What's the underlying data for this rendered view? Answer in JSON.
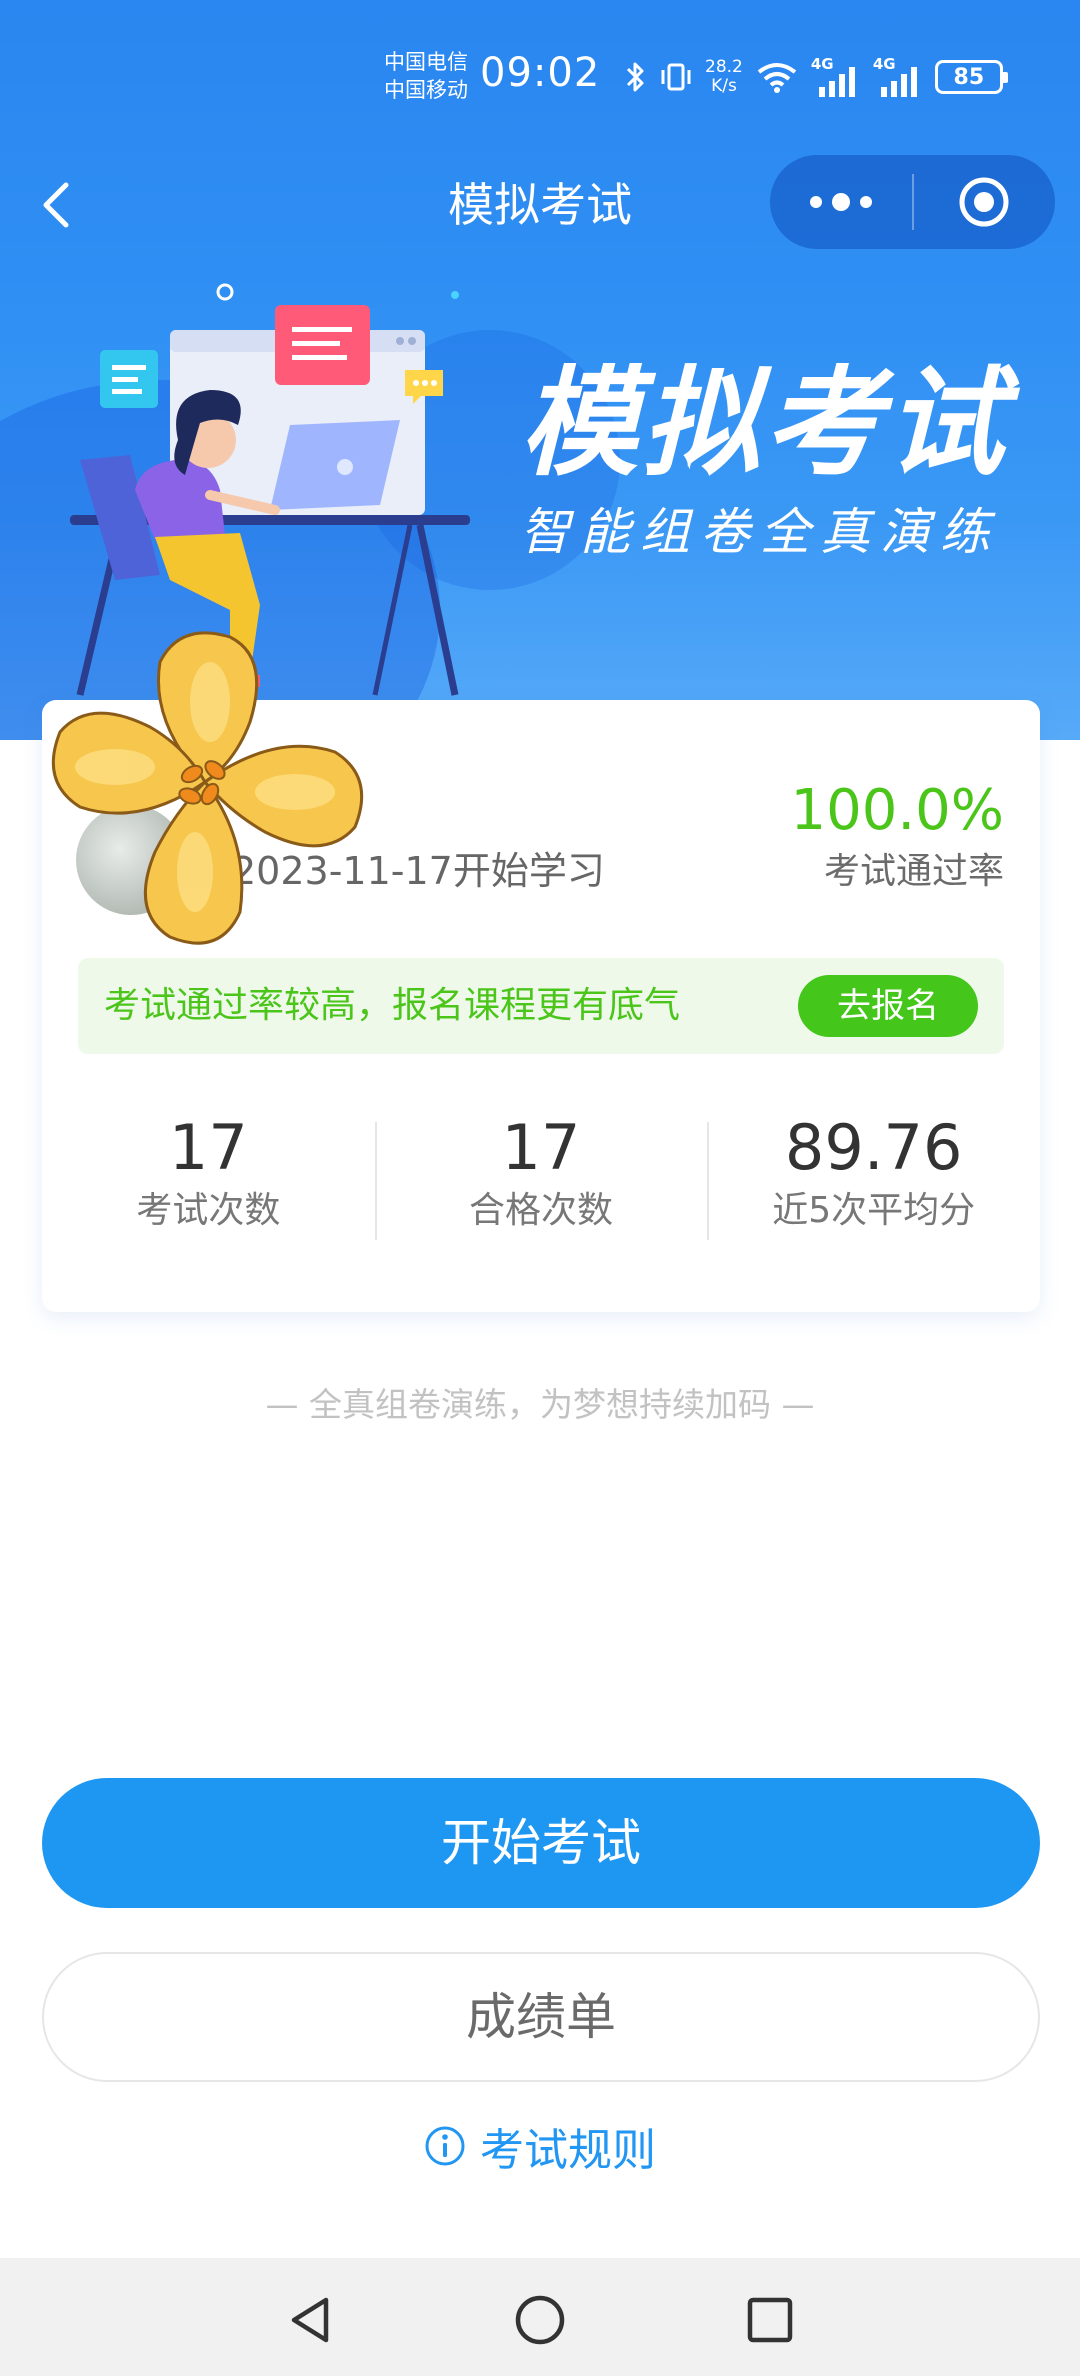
{
  "status_bar": {
    "carrier_1": "中国电信",
    "carrier_2": "中国移动",
    "time": "09:02",
    "net_speed_value": "28.2",
    "net_speed_unit": "K/s",
    "signal_1": "4G",
    "signal_2": "4G",
    "battery": "85"
  },
  "nav": {
    "title": "模拟考试",
    "back_icon": "chevron-left-icon",
    "more_icon": "more-dots-icon",
    "close_icon": "target-circle-icon"
  },
  "banner": {
    "title": "模拟考试",
    "subtitle": "智能组卷全真演练"
  },
  "card": {
    "study_date": "2023-11-17开始学习",
    "pass_rate": "100.0%",
    "pass_rate_label": "考试通过率",
    "promo_text": "考试通过率较高，报名课程更有底气",
    "promo_button": "去报名",
    "stats": [
      {
        "value": "17",
        "label": "考试次数"
      },
      {
        "value": "17",
        "label": "合格次数"
      },
      {
        "value": "89.76",
        "label": "近5次平均分"
      }
    ]
  },
  "slogan": "— 全真组卷演练，为梦想持续加码 —",
  "buttons": {
    "start": "开始考试",
    "report": "成绩单",
    "rules": "考试规则"
  },
  "colors": {
    "primary": "#1e97f3",
    "success": "#44c71a",
    "header": "#2f8ff3"
  }
}
